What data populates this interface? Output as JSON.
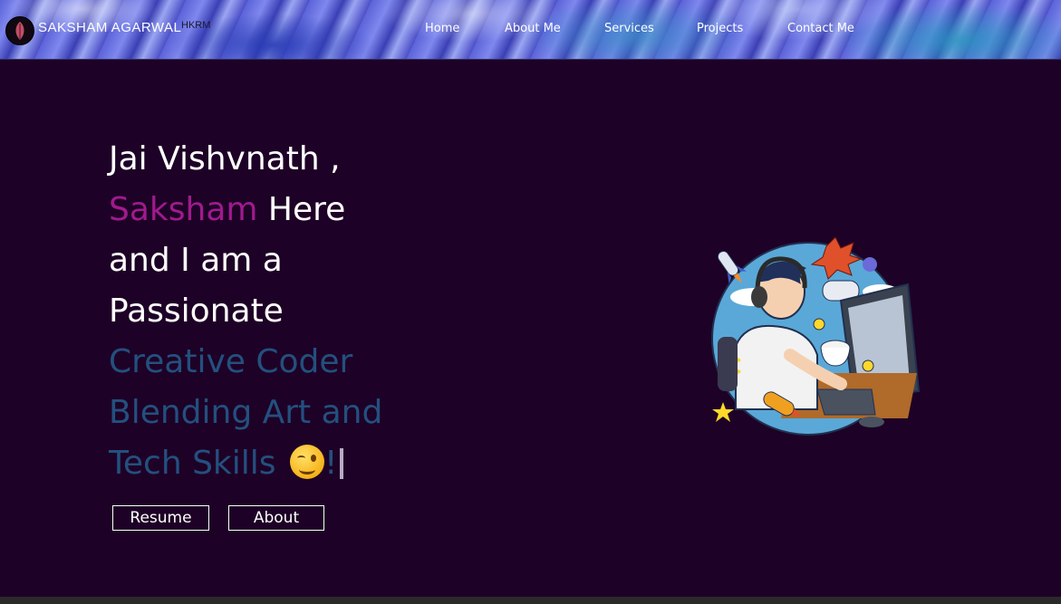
{
  "header": {
    "brand": "SAKSHAM AGARWAL",
    "brand_sup": "HKRM",
    "logo_icon": "leaf-logo-icon",
    "nav": [
      "Home",
      "About Me",
      "Services",
      "Projects",
      "Contact Me"
    ]
  },
  "hero": {
    "line1": "Jai Vishvnath ,",
    "name": "Saksham",
    "line2_rest": " Here",
    "line3": "and I am a",
    "line4": "Passionate",
    "line5": "Creative Coder",
    "line6": "Blending Art and",
    "line7": "Tech Skills",
    "emoji_icon": "wink-emoji-icon",
    "line7_end": "!",
    "colors": {
      "name": "#a01a8e",
      "typed": "#23507f",
      "background": "#1e0126"
    }
  },
  "buttons": {
    "resume": "Resume",
    "about": "About"
  },
  "illustration": {
    "icon": "gamer-coder-illustration"
  }
}
